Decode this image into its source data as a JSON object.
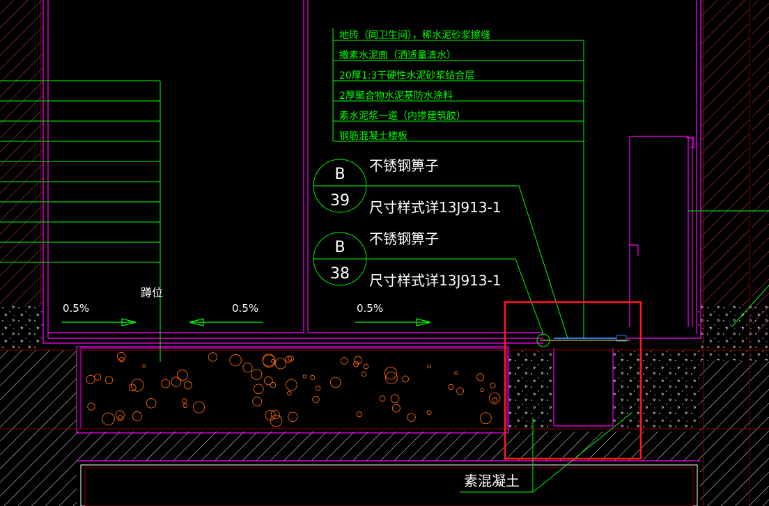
{
  "layer_notes": [
    "地砖（同卫生间），稀水泥砂浆擦缝",
    "撒素水泥面（洒适量清水）",
    "20厚1:3干硬性水泥砂浆结合层",
    "2厚聚合物水泥基防水涂料",
    "素水泥浆一道（内掺建筑胶）",
    "钢筋混凝土楼板"
  ],
  "callouts": [
    {
      "letter": "B",
      "number": "39",
      "top_text": "不锈钢箅子",
      "bottom_text": "尺寸样式详13J913-1"
    },
    {
      "letter": "B",
      "number": "38",
      "top_text": "不锈钢箅子",
      "bottom_text": "尺寸样式详13J913-1"
    }
  ],
  "slopes": [
    "0.5%",
    "0.5%",
    "0.5%"
  ],
  "squat_label": "蹲位",
  "concrete_label": "素混凝土",
  "colors": {
    "background": "#000000",
    "leader": "#00ff00",
    "leader_dark": "#009e00",
    "wall_outline": "#ff00ff",
    "hatch": "#ffffff",
    "aggregate": "#ff6a00",
    "gutter_line": "#ffff00",
    "grate": "#2f7fff",
    "highlight": "#ff1a1a",
    "grid": "#8b0000"
  }
}
